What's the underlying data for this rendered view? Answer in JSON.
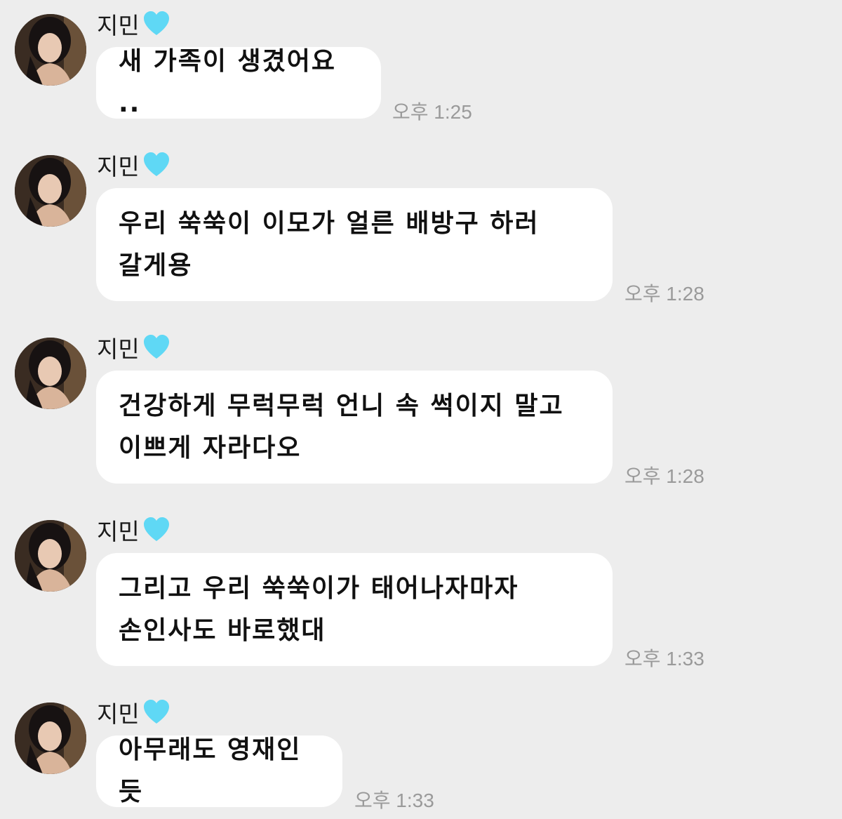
{
  "sender_name": "지민",
  "icons": {
    "heart": "light-blue-heart-icon",
    "avatar": "profile-photo-avatar"
  },
  "colors": {
    "background": "#ededed",
    "bubble": "#ffffff",
    "heart": "#5fd8f5",
    "time_text": "#9a9a9a"
  },
  "messages": [
    {
      "text": "새 가족이 생겼어요 ..",
      "time": "오후 1:25"
    },
    {
      "text": "우리 쑥쑥이 이모가 얼른 배방구 하러\n갈게용",
      "time": "오후 1:28"
    },
    {
      "text": "건강하게 무럭무럭 언니 속 썩이지 말고\n이쁘게 자라다오",
      "time": "오후 1:28"
    },
    {
      "text": "그리고 우리 쑥쑥이가 태어나자마자\n손인사도 바로했대",
      "time": "오후 1:33"
    },
    {
      "text": "아무래도 영재인듯",
      "time": "오후 1:33"
    }
  ]
}
